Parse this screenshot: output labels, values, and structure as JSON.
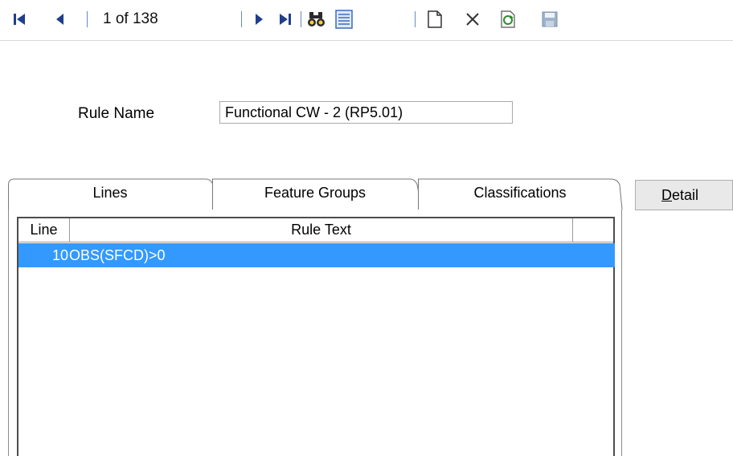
{
  "toolbar": {
    "record_position": "1 of 138",
    "icons": [
      "first-record-icon",
      "previous-record-icon",
      "next-record-icon",
      "last-record-icon",
      "find-icon",
      "list-view-icon",
      "new-record-icon",
      "delete-icon",
      "refresh-icon",
      "save-icon"
    ]
  },
  "form": {
    "rule_name_label": "Rule Name",
    "rule_name_value": "Functional CW - 2 (RP5.01)"
  },
  "tabs": [
    {
      "label": "Lines",
      "active": true
    },
    {
      "label": "Feature Groups",
      "active": false
    },
    {
      "label": "Classifications",
      "active": false
    }
  ],
  "grid": {
    "columns": [
      "Line",
      "Rule Text"
    ],
    "rows": [
      {
        "line": "10",
        "text": "OBS(SFCD)>0",
        "selected": true
      }
    ]
  },
  "detail_button": {
    "label_accel": "D",
    "label_rest": "etail"
  },
  "colors": {
    "icon_blue": "#1f3e8c",
    "selection": "#3399ff"
  }
}
